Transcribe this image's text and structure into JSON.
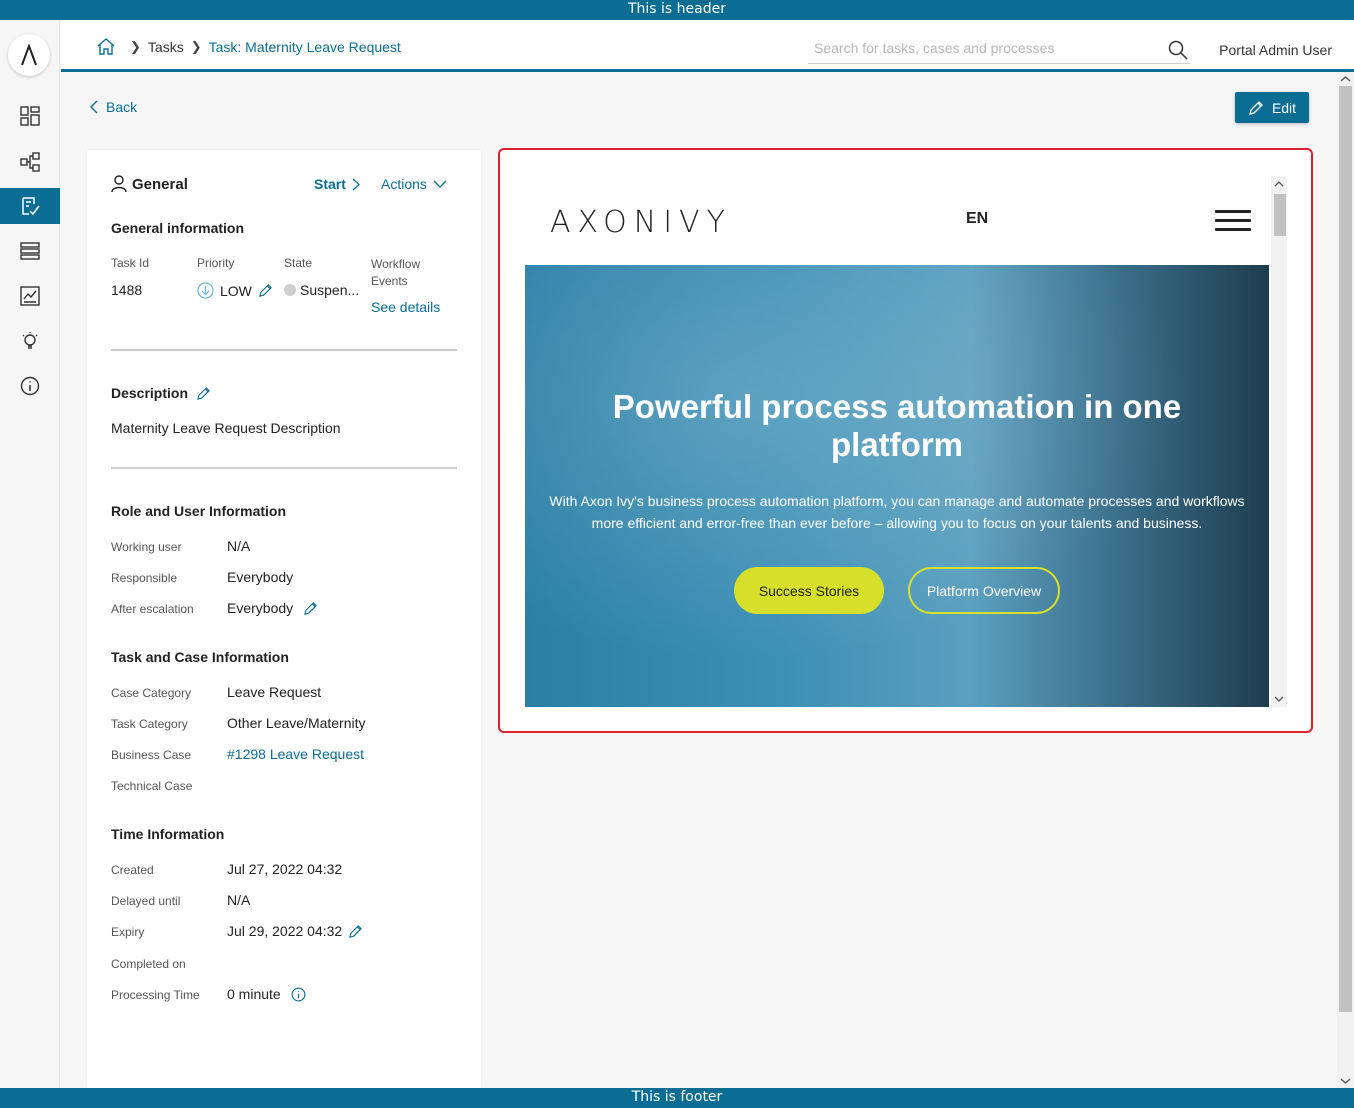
{
  "banner": {
    "header_text": "This is header",
    "footer_text": "This is footer"
  },
  "brand_color": "#0b6d94",
  "sidebar": {
    "items": [
      {
        "name": "dashboard-icon"
      },
      {
        "name": "processes-icon"
      },
      {
        "name": "tasks-icon",
        "active": true
      },
      {
        "name": "cases-icon"
      },
      {
        "name": "statistics-icon"
      },
      {
        "name": "lightbulb-icon"
      },
      {
        "name": "info-icon"
      }
    ]
  },
  "topbar": {
    "breadcrumb": [
      "Tasks",
      "Task: Maternity Leave Request"
    ],
    "search_placeholder": "Search for tasks, cases and processes",
    "user_name": "Portal Admin User"
  },
  "page": {
    "back_label": "Back",
    "edit_label": "Edit"
  },
  "general": {
    "title": "General",
    "start_label": "Start",
    "actions_label": "Actions",
    "info_title": "General information",
    "task_id_label": "Task Id",
    "task_id": "1488",
    "priority_label": "Priority",
    "priority": "LOW",
    "state_label": "State",
    "state": "Suspen...",
    "workflow_label": "Workflow Events",
    "workflow_link": "See details",
    "description_title": "Description",
    "description": "Maternity Leave Request Description",
    "role_title": "Role and User Information",
    "working_user_label": "Working user",
    "working_user": "N/A",
    "responsible_label": "Responsible",
    "responsible": "Everybody",
    "after_escalation_label": "After escalation",
    "after_escalation": "Everybody",
    "task_case_title": "Task and Case Information",
    "case_category_label": "Case Category",
    "case_category": "Leave Request",
    "task_category_label": "Task Category",
    "task_category": "Other Leave/Maternity",
    "business_case_label": "Business Case",
    "business_case": "#1298 Leave Request",
    "technical_case_label": "Technical Case",
    "time_title": "Time Information",
    "created_label": "Created",
    "created": "Jul 27, 2022 04:32",
    "delayed_label": "Delayed until",
    "delayed": "N/A",
    "expiry_label": "Expiry",
    "expiry": "Jul 29, 2022 04:32",
    "completed_label": "Completed on",
    "processing_label": "Processing Time",
    "processing": "0 minute"
  },
  "embedded_site": {
    "logo_text": "AXONIVY",
    "lang": "EN",
    "hero_title": "Powerful process automation in one platform",
    "hero_text": "With Axon Ivy's business process automation platform, you can manage and automate processes and workflows more efficient and error-free than ever before – allowing you to focus on your talents and business.",
    "btn_primary": "Success Stories",
    "btn_secondary": "Platform Overview",
    "accent_color": "#d6e02a"
  }
}
